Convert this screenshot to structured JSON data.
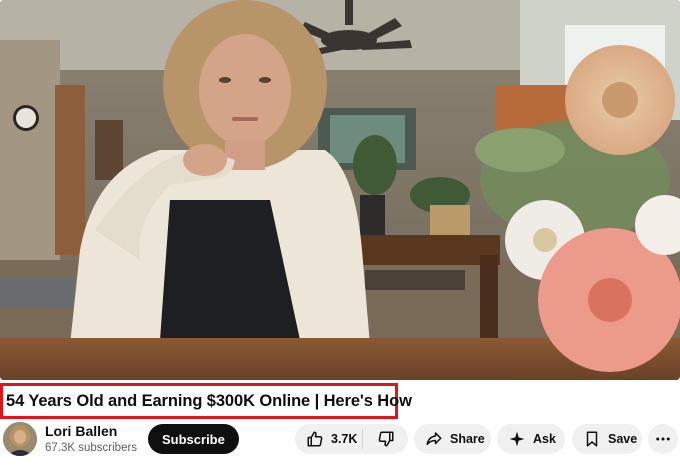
{
  "video": {
    "title": "54 Years Old and Earning $300K Online | Here's How"
  },
  "channel": {
    "name": "Lori Ballen",
    "subscribers": "67.3K subscribers"
  },
  "actions": {
    "subscribe_label": "Subscribe",
    "like_count": "3.7K",
    "share_label": "Share",
    "ask_label": "Ask",
    "save_label": "Save"
  },
  "icons": {
    "like": "thumbs-up-icon",
    "dislike": "thumbs-down-icon",
    "share": "share-arrow-icon",
    "ask": "sparkle-icon",
    "save": "bookmark-icon",
    "more": "more-horizontal-icon"
  },
  "colors": {
    "highlight_border": "#e4121b",
    "subscribe_bg": "#0f0f0f",
    "pill_bg": "#f0f0f0"
  }
}
